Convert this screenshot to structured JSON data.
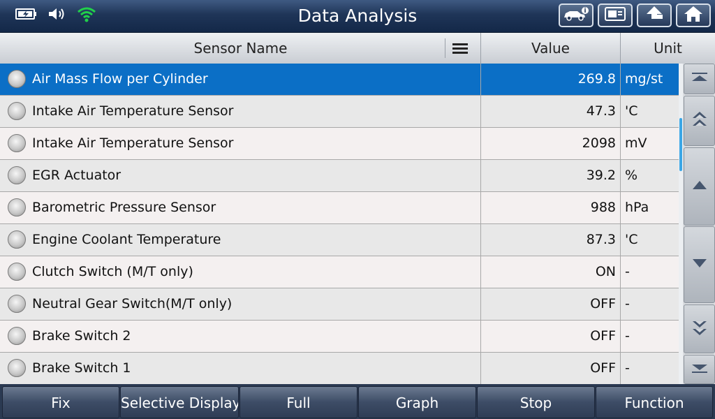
{
  "title": "Data Analysis",
  "status_icons": [
    "battery-charging-icon",
    "speaker-icon",
    "wifi-icon"
  ],
  "title_buttons": [
    "vehicle-info-icon",
    "report-icon",
    "back-icon",
    "home-icon"
  ],
  "columns": {
    "name": "Sensor Name",
    "value": "Value",
    "unit": "Unit"
  },
  "rows": [
    {
      "name": "Air Mass Flow per Cylinder",
      "value": "269.8",
      "unit": "mg/st",
      "selected": true
    },
    {
      "name": "Intake Air Temperature Sensor",
      "value": "47.3",
      "unit": "'C"
    },
    {
      "name": "Intake Air Temperature Sensor",
      "value": "2098",
      "unit": "mV"
    },
    {
      "name": "EGR Actuator",
      "value": "39.2",
      "unit": "%"
    },
    {
      "name": "Barometric Pressure Sensor",
      "value": "988",
      "unit": "hPa"
    },
    {
      "name": "Engine Coolant Temperature",
      "value": "87.3",
      "unit": "'C"
    },
    {
      "name": "Clutch Switch (M/T only)",
      "value": "ON",
      "unit": "-"
    },
    {
      "name": "Neutral Gear Switch(M/T only)",
      "value": "OFF",
      "unit": "-"
    },
    {
      "name": "Brake Switch 2",
      "value": "OFF",
      "unit": "-"
    },
    {
      "name": "Brake Switch 1",
      "value": "OFF",
      "unit": "-"
    }
  ],
  "scroll_buttons": [
    "scroll-top-icon",
    "page-up-icon",
    "line-up-icon",
    "line-down-icon",
    "page-down-icon",
    "scroll-bottom-icon"
  ],
  "bottom_buttons": [
    "Fix",
    "Selective Display",
    "Full",
    "Graph",
    "Stop",
    "Function"
  ],
  "colors": {
    "selected_row": "#0b6fc6",
    "wifi": "#21d14a",
    "scroll_thumb": "#3aa6e6"
  }
}
